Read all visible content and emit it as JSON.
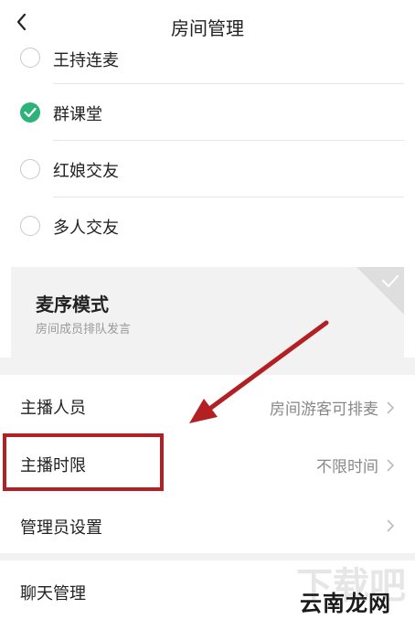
{
  "header": {
    "title": "房间管理",
    "back_icon": "chevron-left-icon"
  },
  "radio_options": [
    {
      "label": "王持连麦",
      "checked": false
    },
    {
      "label": "群课堂",
      "checked": true
    },
    {
      "label": "红娘交友",
      "checked": false
    },
    {
      "label": "多人交友",
      "checked": false
    }
  ],
  "mode_card": {
    "title": "麦序模式",
    "subtitle": "房间成员排队发言",
    "selected": false
  },
  "rows": {
    "host": {
      "label": "主播人员",
      "value": "房间游客可排麦"
    },
    "limit": {
      "label": "主播时限",
      "value": "不限时间"
    },
    "admin": {
      "label": "管理员设置"
    },
    "chat": {
      "label": "聊天管理"
    }
  },
  "watermark": {
    "text": "云南龙网",
    "ghost": "下载吧"
  },
  "colors": {
    "accent_green": "#2db37a",
    "annotation_red": "#b32024",
    "card_bg": "#f2f2f2"
  }
}
